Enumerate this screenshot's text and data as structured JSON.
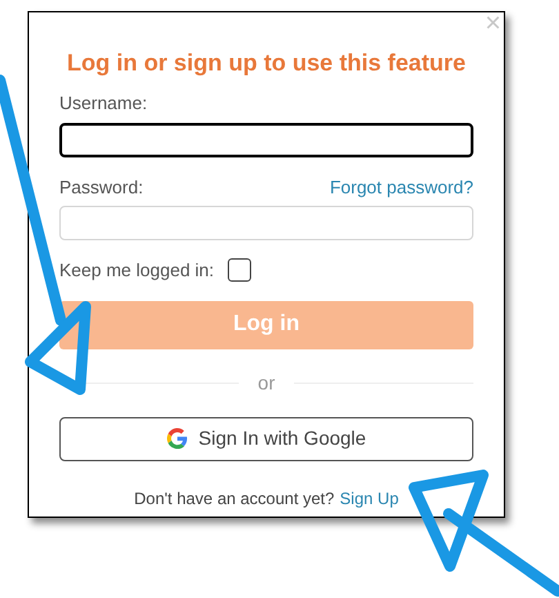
{
  "dialog": {
    "title": "Log in or sign up to use this feature",
    "close": "×",
    "fields": [
      {
        "label": "Username:",
        "focused": true
      },
      {
        "label": "Password:",
        "link": "Forgot password?",
        "focused": false
      }
    ],
    "remember": {
      "label": "Keep me logged in:",
      "checked": false
    },
    "login_button": "Log in",
    "divider": "or",
    "google_button": "Sign In with Google",
    "footer": {
      "text": "Don't have an account yet?",
      "link": "Sign Up"
    }
  }
}
